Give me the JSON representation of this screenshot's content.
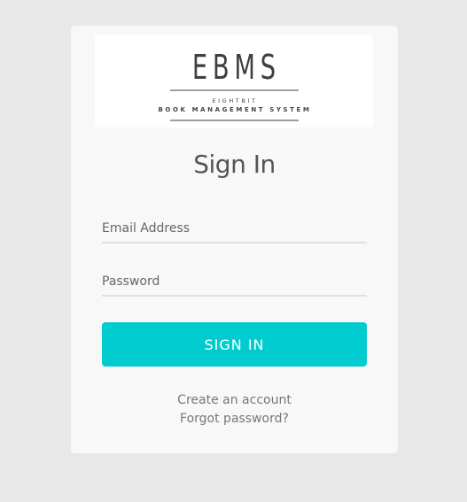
{
  "logo": {
    "mark": "EBMS",
    "line1": "EIGHTBIT",
    "line2": "BOOK MANAGEMENT SYSTEM"
  },
  "form": {
    "title": "Sign In",
    "email_placeholder": "Email Address",
    "password_placeholder": "Password",
    "submit_label": "SIGN IN",
    "submit_color": "#00ccd0"
  },
  "links": {
    "create_account": "Create an account",
    "forgot_password": "Forgot password?"
  }
}
